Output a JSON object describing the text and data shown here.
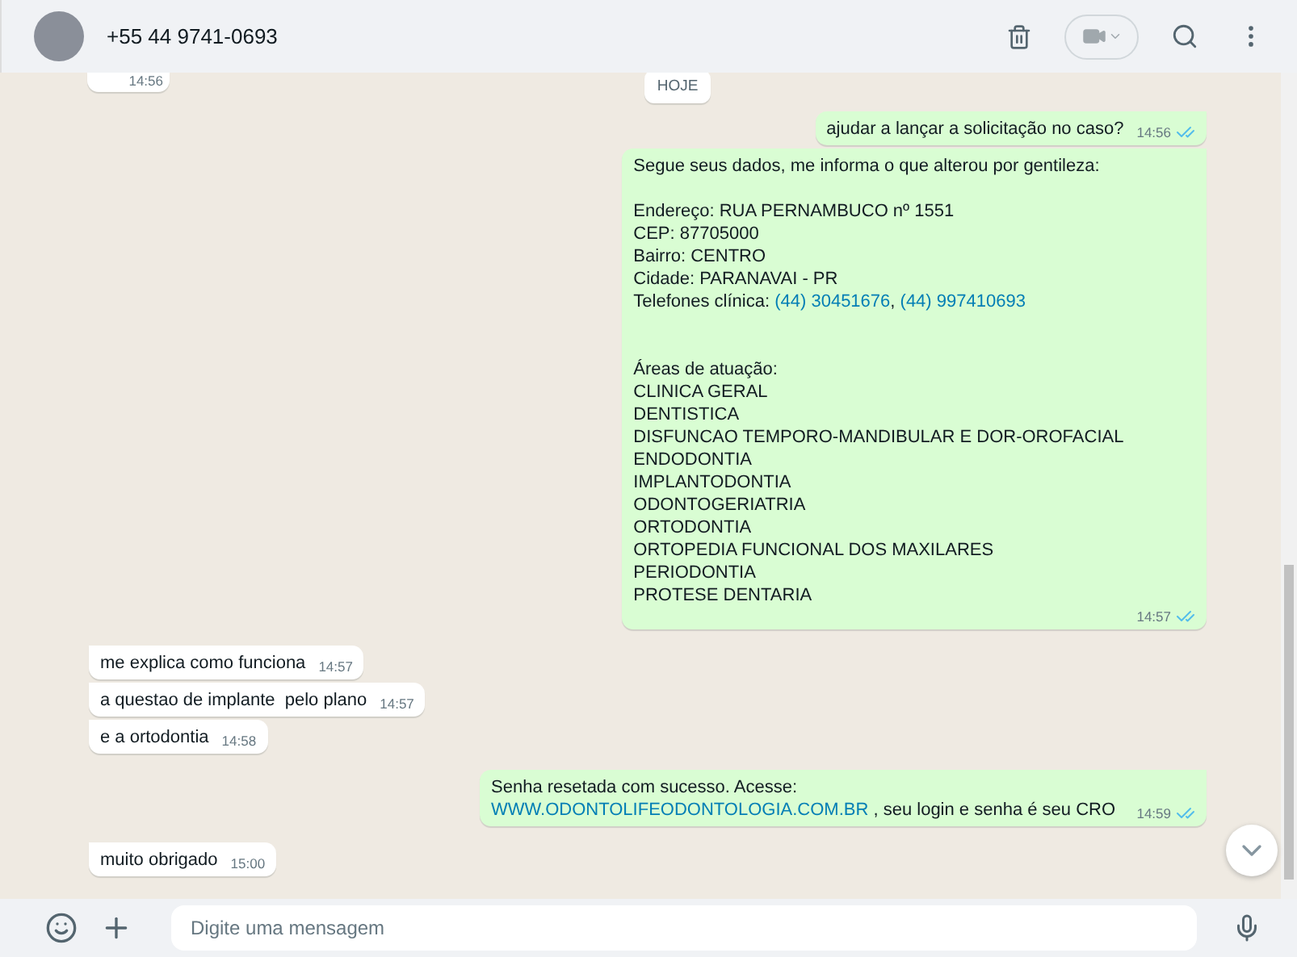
{
  "header": {
    "contact": "+55 44 9741-0693"
  },
  "date_chip": "HOJE",
  "top_partial": {
    "time": "14:56"
  },
  "messages": [
    {
      "kind": "out",
      "segments": [
        {
          "text": "ajudar a lançar a solicitação no caso?",
          "link": false
        }
      ],
      "time": "14:56",
      "read": true
    },
    {
      "kind": "out",
      "segments": [
        {
          "text": "Segue seus dados, me informa o que alterou por gentileza:\n\nEndereço: RUA PERNAMBUCO nº 1551\nCEP: 87705000\nBairro: CENTRO\nCidade: PARANAVAI - PR\nTelefones clínica: ",
          "link": false
        },
        {
          "text": "(44) 30451676",
          "link": true
        },
        {
          "text": ", ",
          "link": false
        },
        {
          "text": "(44) 997410693",
          "link": true
        },
        {
          "text": "\n\n\nÁreas de atuação:\nCLINICA GERAL\nDENTISTICA\nDISFUNCAO TEMPORO-MANDIBULAR E DOR-OROFACIAL\nENDODONTIA\nIMPLANTODONTIA\nODONTOGERIATRIA\nORTODONTIA\nORTOPEDIA FUNCIONAL DOS MAXILARES\nPERIODONTIA\nPROTESE DENTARIA",
          "link": false
        }
      ],
      "time": "14:57",
      "read": true
    },
    {
      "kind": "in",
      "segments": [
        {
          "text": "me explica como funciona",
          "link": false
        }
      ],
      "time": "14:57"
    },
    {
      "kind": "in",
      "segments": [
        {
          "text": "a questao de implante  pelo plano",
          "link": false
        }
      ],
      "time": "14:57"
    },
    {
      "kind": "in",
      "segments": [
        {
          "text": "e a ortodontia",
          "link": false
        }
      ],
      "time": "14:58"
    },
    {
      "kind": "out",
      "segments": [
        {
          "text": "Senha resetada com sucesso. Acesse: ",
          "link": false
        },
        {
          "text": "WWW.ODONTOLIFEODONTOLOGIA.COM.BR",
          "link": true
        },
        {
          "text": " , seu login e senha é seu CRO",
          "link": false
        }
      ],
      "time": "14:59",
      "read": true
    },
    {
      "kind": "in",
      "segments": [
        {
          "text": "muito obrigado",
          "link": false
        }
      ],
      "time": "15:00"
    }
  ],
  "composer": {
    "placeholder": "Digite uma mensagem"
  }
}
